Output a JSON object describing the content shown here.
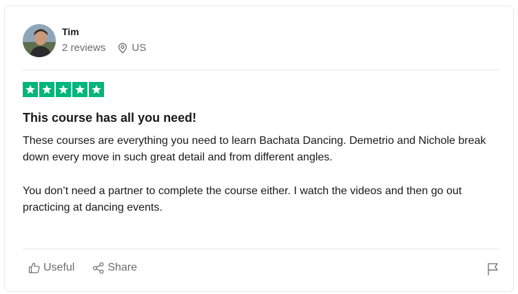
{
  "reviewer": {
    "name": "Tim",
    "reviews_count": "2 reviews",
    "country": "US"
  },
  "review": {
    "rating": 5,
    "max_rating": 5,
    "title": "This course has all you need!",
    "paragraphs": [
      "These courses are everything you need to learn Bachata Dancing. Demetrio and Nichole break down every move in such great detail and from different angles.",
      "You don’t need a partner to complete the course either. I watch the videos and then go out practicing at dancing events."
    ]
  },
  "actions": {
    "useful_label": "Useful",
    "share_label": "Share"
  },
  "icons": {
    "location": "map-pin-icon",
    "useful": "thumbs-up-icon",
    "share": "share-icon",
    "report": "flag-icon"
  },
  "colors": {
    "star_green": "#00b67a",
    "text_primary": "#191919",
    "text_secondary": "#6b6b6b"
  }
}
